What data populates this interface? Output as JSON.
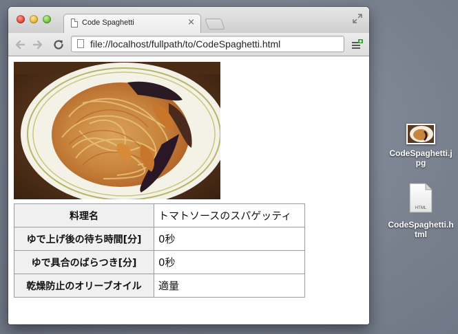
{
  "browser": {
    "tab_title": "Code Spaghetti",
    "url": "file://localhost/fullpath/to/CodeSpaghetti.html"
  },
  "page": {
    "image_alt": "spaghetti-photo",
    "table": {
      "rows": [
        {
          "header": "料理名",
          "value": "トマトソースのスパゲッティ"
        },
        {
          "header": "ゆで上げ後の待ち時間[分]",
          "value": "0秒"
        },
        {
          "header": "ゆで具合のばらつき[分]",
          "value": "0秒"
        },
        {
          "header": "乾燥防止のオリーブオイル",
          "value": "適量"
        }
      ]
    }
  },
  "desktop": {
    "files": [
      {
        "label": "CodeSpaghetti.jpg",
        "icon": "jpg-thumbnail-icon"
      },
      {
        "label": "CodeSpaghetti.html",
        "icon": "html-file-icon"
      }
    ],
    "html_badge": "HTML"
  },
  "colors": {
    "desktop": "#7d8594",
    "table_header_bg": "#f0f0f0",
    "table_border": "#9c9c9c"
  }
}
